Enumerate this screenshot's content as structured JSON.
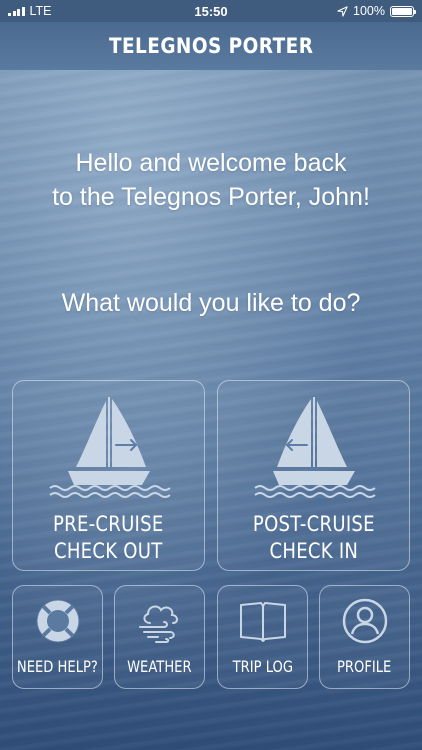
{
  "status_bar": {
    "carrier": "LTE",
    "time": "15:50",
    "battery": "100%",
    "battery_level": 1.0
  },
  "header": {
    "title": "TELEGNOS PORTER"
  },
  "welcome": {
    "line1": "Hello and welcome back",
    "line2": "to the Telegnos Porter, John!"
  },
  "question": "What would you like to do?",
  "main_actions": [
    {
      "line1": "PRE-CRUISE",
      "line2": "CHECK OUT",
      "icon": "sailboat-arrow-right-icon"
    },
    {
      "line1": "POST-CRUISE",
      "line2": "CHECK IN",
      "icon": "sailboat-arrow-left-icon"
    }
  ],
  "secondary_actions": [
    {
      "label": "NEED HELP?",
      "icon": "lifebuoy-icon"
    },
    {
      "label": "WEATHER",
      "icon": "wind-cloud-icon"
    },
    {
      "label": "TRIP LOG",
      "icon": "open-book-icon"
    },
    {
      "label": "PROFILE",
      "icon": "user-profile-icon"
    }
  ],
  "colors": {
    "icon_fill": "#c9d6e6",
    "text": "#ffffff",
    "status_bar_bg": "#3f5b7e"
  }
}
